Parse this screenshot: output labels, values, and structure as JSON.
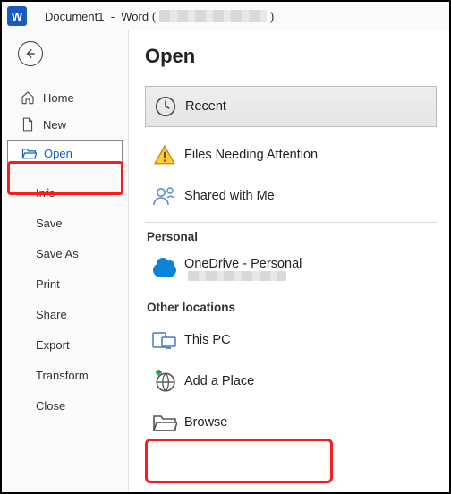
{
  "titlebar": {
    "app_icon_letter": "W",
    "doc_name": "Document1",
    "separator": "  -  ",
    "app_name": "Word",
    "paren_open": " (",
    "paren_close": ")"
  },
  "sidebar": {
    "home": "Home",
    "new": "New",
    "open": "Open",
    "info": "Info",
    "save": "Save",
    "save_as": "Save As",
    "print": "Print",
    "share": "Share",
    "export": "Export",
    "transform": "Transform",
    "close": "Close"
  },
  "main": {
    "heading": "Open",
    "recent": "Recent",
    "attention": "Files Needing Attention",
    "shared": "Shared with Me",
    "section_personal": "Personal",
    "onedrive": "OneDrive - Personal",
    "section_other": "Other locations",
    "this_pc": "This PC",
    "add_place": "Add a Place",
    "browse": "Browse"
  }
}
